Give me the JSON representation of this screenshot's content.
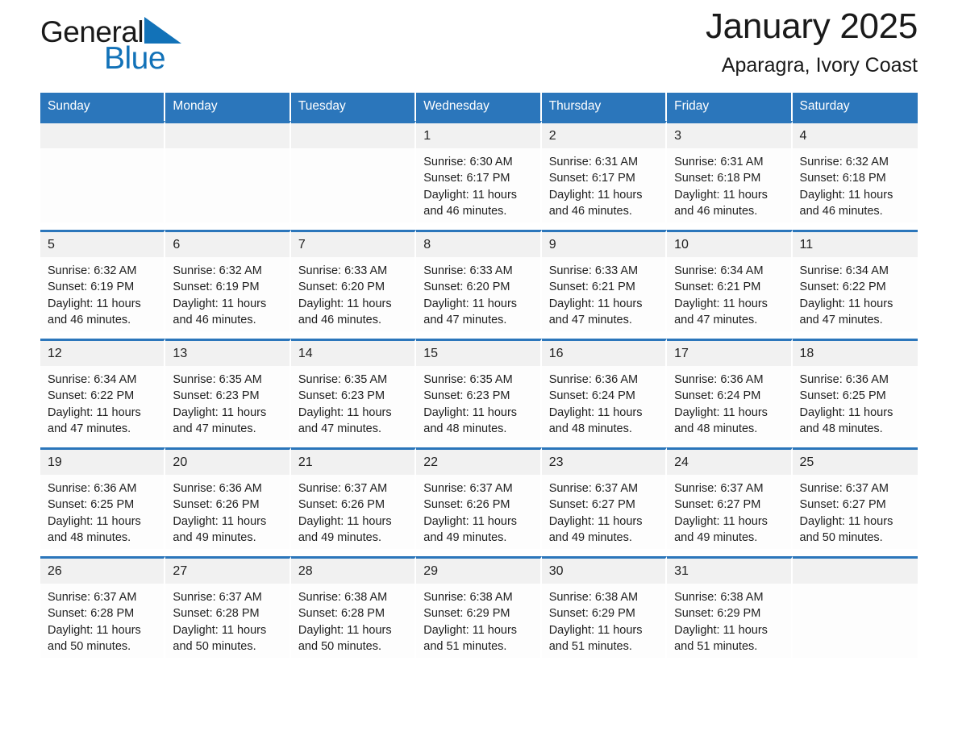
{
  "brand": {
    "name_part1": "General",
    "name_part2": "Blue",
    "triangle_icon": "blue-triangle-logo-mark",
    "colors": {
      "accent": "#1272b8",
      "text": "#1a1a1a"
    }
  },
  "header": {
    "title": "January 2025",
    "location": "Aparagra, Ivory Coast"
  },
  "calendar": {
    "header_bg": "#2b76bb",
    "header_text_color": "#ffffff",
    "row_rule_color": "#2b76bb",
    "daynum_bg": "#f1f1f1",
    "weekdays": [
      "Sunday",
      "Monday",
      "Tuesday",
      "Wednesday",
      "Thursday",
      "Friday",
      "Saturday"
    ],
    "weeks": [
      [
        {
          "day": "",
          "sunrise": "",
          "sunset": "",
          "daylight_line1": "",
          "daylight_line2": "",
          "empty": true
        },
        {
          "day": "",
          "sunrise": "",
          "sunset": "",
          "daylight_line1": "",
          "daylight_line2": "",
          "empty": true
        },
        {
          "day": "",
          "sunrise": "",
          "sunset": "",
          "daylight_line1": "",
          "daylight_line2": "",
          "empty": true
        },
        {
          "day": "1",
          "sunrise": "Sunrise: 6:30 AM",
          "sunset": "Sunset: 6:17 PM",
          "daylight_line1": "Daylight: 11 hours",
          "daylight_line2": "and 46 minutes."
        },
        {
          "day": "2",
          "sunrise": "Sunrise: 6:31 AM",
          "sunset": "Sunset: 6:17 PM",
          "daylight_line1": "Daylight: 11 hours",
          "daylight_line2": "and 46 minutes."
        },
        {
          "day": "3",
          "sunrise": "Sunrise: 6:31 AM",
          "sunset": "Sunset: 6:18 PM",
          "daylight_line1": "Daylight: 11 hours",
          "daylight_line2": "and 46 minutes."
        },
        {
          "day": "4",
          "sunrise": "Sunrise: 6:32 AM",
          "sunset": "Sunset: 6:18 PM",
          "daylight_line1": "Daylight: 11 hours",
          "daylight_line2": "and 46 minutes."
        }
      ],
      [
        {
          "day": "5",
          "sunrise": "Sunrise: 6:32 AM",
          "sunset": "Sunset: 6:19 PM",
          "daylight_line1": "Daylight: 11 hours",
          "daylight_line2": "and 46 minutes."
        },
        {
          "day": "6",
          "sunrise": "Sunrise: 6:32 AM",
          "sunset": "Sunset: 6:19 PM",
          "daylight_line1": "Daylight: 11 hours",
          "daylight_line2": "and 46 minutes."
        },
        {
          "day": "7",
          "sunrise": "Sunrise: 6:33 AM",
          "sunset": "Sunset: 6:20 PM",
          "daylight_line1": "Daylight: 11 hours",
          "daylight_line2": "and 46 minutes."
        },
        {
          "day": "8",
          "sunrise": "Sunrise: 6:33 AM",
          "sunset": "Sunset: 6:20 PM",
          "daylight_line1": "Daylight: 11 hours",
          "daylight_line2": "and 47 minutes."
        },
        {
          "day": "9",
          "sunrise": "Sunrise: 6:33 AM",
          "sunset": "Sunset: 6:21 PM",
          "daylight_line1": "Daylight: 11 hours",
          "daylight_line2": "and 47 minutes."
        },
        {
          "day": "10",
          "sunrise": "Sunrise: 6:34 AM",
          "sunset": "Sunset: 6:21 PM",
          "daylight_line1": "Daylight: 11 hours",
          "daylight_line2": "and 47 minutes."
        },
        {
          "day": "11",
          "sunrise": "Sunrise: 6:34 AM",
          "sunset": "Sunset: 6:22 PM",
          "daylight_line1": "Daylight: 11 hours",
          "daylight_line2": "and 47 minutes."
        }
      ],
      [
        {
          "day": "12",
          "sunrise": "Sunrise: 6:34 AM",
          "sunset": "Sunset: 6:22 PM",
          "daylight_line1": "Daylight: 11 hours",
          "daylight_line2": "and 47 minutes."
        },
        {
          "day": "13",
          "sunrise": "Sunrise: 6:35 AM",
          "sunset": "Sunset: 6:23 PM",
          "daylight_line1": "Daylight: 11 hours",
          "daylight_line2": "and 47 minutes."
        },
        {
          "day": "14",
          "sunrise": "Sunrise: 6:35 AM",
          "sunset": "Sunset: 6:23 PM",
          "daylight_line1": "Daylight: 11 hours",
          "daylight_line2": "and 47 minutes."
        },
        {
          "day": "15",
          "sunrise": "Sunrise: 6:35 AM",
          "sunset": "Sunset: 6:23 PM",
          "daylight_line1": "Daylight: 11 hours",
          "daylight_line2": "and 48 minutes."
        },
        {
          "day": "16",
          "sunrise": "Sunrise: 6:36 AM",
          "sunset": "Sunset: 6:24 PM",
          "daylight_line1": "Daylight: 11 hours",
          "daylight_line2": "and 48 minutes."
        },
        {
          "day": "17",
          "sunrise": "Sunrise: 6:36 AM",
          "sunset": "Sunset: 6:24 PM",
          "daylight_line1": "Daylight: 11 hours",
          "daylight_line2": "and 48 minutes."
        },
        {
          "day": "18",
          "sunrise": "Sunrise: 6:36 AM",
          "sunset": "Sunset: 6:25 PM",
          "daylight_line1": "Daylight: 11 hours",
          "daylight_line2": "and 48 minutes."
        }
      ],
      [
        {
          "day": "19",
          "sunrise": "Sunrise: 6:36 AM",
          "sunset": "Sunset: 6:25 PM",
          "daylight_line1": "Daylight: 11 hours",
          "daylight_line2": "and 48 minutes."
        },
        {
          "day": "20",
          "sunrise": "Sunrise: 6:36 AM",
          "sunset": "Sunset: 6:26 PM",
          "daylight_line1": "Daylight: 11 hours",
          "daylight_line2": "and 49 minutes."
        },
        {
          "day": "21",
          "sunrise": "Sunrise: 6:37 AM",
          "sunset": "Sunset: 6:26 PM",
          "daylight_line1": "Daylight: 11 hours",
          "daylight_line2": "and 49 minutes."
        },
        {
          "day": "22",
          "sunrise": "Sunrise: 6:37 AM",
          "sunset": "Sunset: 6:26 PM",
          "daylight_line1": "Daylight: 11 hours",
          "daylight_line2": "and 49 minutes."
        },
        {
          "day": "23",
          "sunrise": "Sunrise: 6:37 AM",
          "sunset": "Sunset: 6:27 PM",
          "daylight_line1": "Daylight: 11 hours",
          "daylight_line2": "and 49 minutes."
        },
        {
          "day": "24",
          "sunrise": "Sunrise: 6:37 AM",
          "sunset": "Sunset: 6:27 PM",
          "daylight_line1": "Daylight: 11 hours",
          "daylight_line2": "and 49 minutes."
        },
        {
          "day": "25",
          "sunrise": "Sunrise: 6:37 AM",
          "sunset": "Sunset: 6:27 PM",
          "daylight_line1": "Daylight: 11 hours",
          "daylight_line2": "and 50 minutes."
        }
      ],
      [
        {
          "day": "26",
          "sunrise": "Sunrise: 6:37 AM",
          "sunset": "Sunset: 6:28 PM",
          "daylight_line1": "Daylight: 11 hours",
          "daylight_line2": "and 50 minutes."
        },
        {
          "day": "27",
          "sunrise": "Sunrise: 6:37 AM",
          "sunset": "Sunset: 6:28 PM",
          "daylight_line1": "Daylight: 11 hours",
          "daylight_line2": "and 50 minutes."
        },
        {
          "day": "28",
          "sunrise": "Sunrise: 6:38 AM",
          "sunset": "Sunset: 6:28 PM",
          "daylight_line1": "Daylight: 11 hours",
          "daylight_line2": "and 50 minutes."
        },
        {
          "day": "29",
          "sunrise": "Sunrise: 6:38 AM",
          "sunset": "Sunset: 6:29 PM",
          "daylight_line1": "Daylight: 11 hours",
          "daylight_line2": "and 51 minutes."
        },
        {
          "day": "30",
          "sunrise": "Sunrise: 6:38 AM",
          "sunset": "Sunset: 6:29 PM",
          "daylight_line1": "Daylight: 11 hours",
          "daylight_line2": "and 51 minutes."
        },
        {
          "day": "31",
          "sunrise": "Sunrise: 6:38 AM",
          "sunset": "Sunset: 6:29 PM",
          "daylight_line1": "Daylight: 11 hours",
          "daylight_line2": "and 51 minutes."
        },
        {
          "day": "",
          "sunrise": "",
          "sunset": "",
          "daylight_line1": "",
          "daylight_line2": "",
          "empty": true
        }
      ]
    ]
  }
}
